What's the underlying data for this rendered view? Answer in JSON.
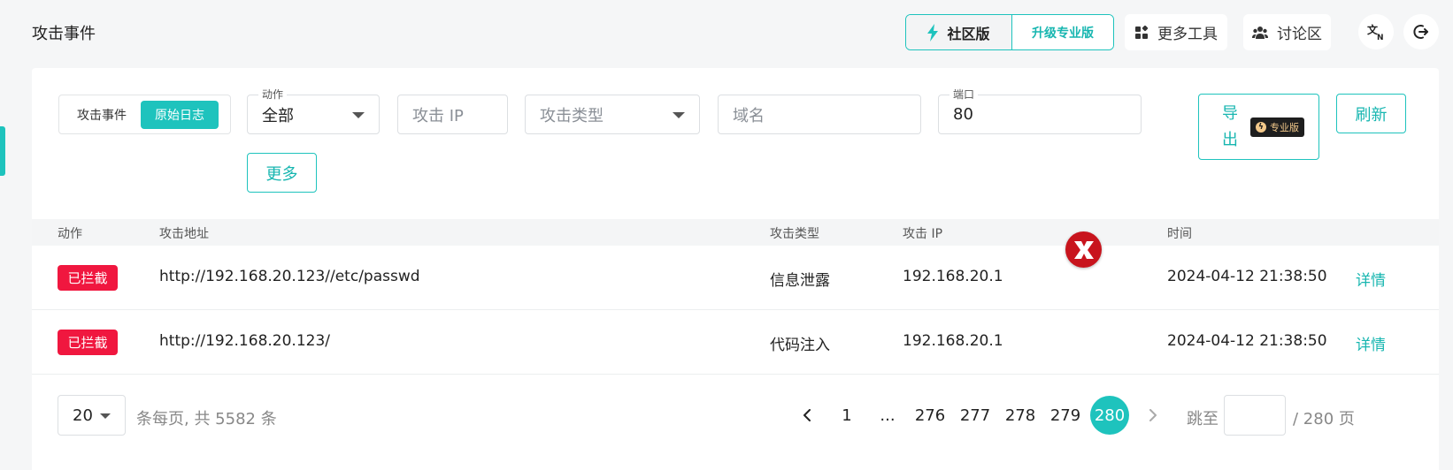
{
  "header": {
    "title": "攻击事件",
    "community_label": "社区版",
    "upgrade_label": "升级专业版",
    "more_tools_label": "更多工具",
    "forum_label": "讨论区"
  },
  "filters": {
    "seg_options": [
      "攻击事件",
      "原始日志"
    ],
    "seg_active": "原始日志",
    "action_label": "动作",
    "action_value": "全部",
    "ip_placeholder": "攻击 IP",
    "type_placeholder": "攻击类型",
    "domain_placeholder": "域名",
    "port_label": "端口",
    "port_value": "80",
    "more_label": "更多",
    "export_label_1": "导",
    "export_label_2": "出",
    "pro_badge": "专业版",
    "refresh_label": "刷新"
  },
  "table": {
    "columns": [
      "动作",
      "攻击地址",
      "攻击类型",
      "攻击 IP",
      "时间"
    ],
    "rows": [
      {
        "action": "已拦截",
        "url": "http://192.168.20.123//etc/passwd",
        "type": "信息泄露",
        "ip": "192.168.20.1",
        "time": "2024-04-12 21:38:50",
        "detail": "详情"
      },
      {
        "action": "已拦截",
        "url": "http://192.168.20.123/",
        "type": "代码注入",
        "ip": "192.168.20.1",
        "time": "2024-04-12 21:38:50",
        "detail": "详情"
      }
    ]
  },
  "pagination": {
    "page_size": "20",
    "total_text": "条每页, 共 5582 条",
    "pages": [
      "1",
      "...",
      "276",
      "277",
      "278",
      "279",
      "280"
    ],
    "current": "280",
    "jump_label": "跳至",
    "total_pages_text": "/ 280 页"
  },
  "colors": {
    "accent": "#1ec3bd",
    "blocked": "#f0173f"
  }
}
